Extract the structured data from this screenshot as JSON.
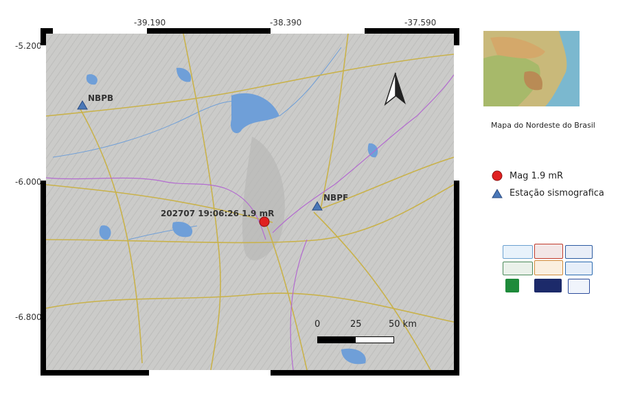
{
  "axes": {
    "top_ticks": [
      "-39.190",
      "-38.390",
      "-37.590"
    ],
    "left_ticks": [
      "-5.200",
      "-6.000",
      "-6.800"
    ]
  },
  "stations": [
    {
      "name": "NBPB"
    },
    {
      "name": "NBPF"
    }
  ],
  "event": {
    "label": "202707 19:06:26 1.9 mR",
    "color": "#e02020"
  },
  "scale_bar": {
    "labels": [
      "0",
      "25",
      "50 km"
    ]
  },
  "inset": {
    "caption": "Mapa do  Nordeste do Brasil"
  },
  "legend": {
    "items": [
      {
        "label": "Mag 1.9 mR",
        "symbol": "circle",
        "color": "#e02020"
      },
      {
        "label": "Estação sismografica",
        "symbol": "triangle",
        "color": "#4a78b8"
      }
    ]
  },
  "logos": [
    {
      "name": "labsis-logo"
    },
    {
      "name": "rsisne-logo"
    },
    {
      "name": "ufrn-logo"
    },
    {
      "name": "inct-logo"
    },
    {
      "name": "unnamed-logo"
    },
    {
      "name": "cnpq-logo"
    },
    {
      "name": "petrobras-logo"
    },
    {
      "name": "rsbr-logo"
    },
    {
      "name": "cprm-logo"
    }
  ],
  "colors": {
    "station": "#4a78b8",
    "event": "#e02020",
    "water": "#6f9fd8",
    "road": "#c9b24a",
    "boundary": "#b36ad0"
  }
}
